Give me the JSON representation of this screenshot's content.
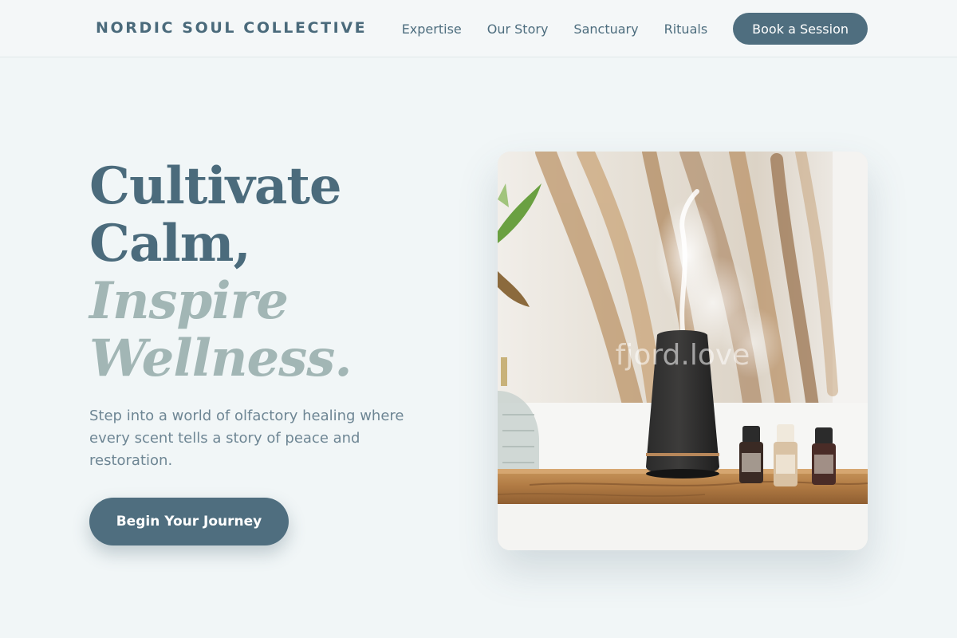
{
  "header": {
    "brand": "NORDIC SOUL COLLECTIVE",
    "nav": [
      {
        "label": "Expertise"
      },
      {
        "label": "Our Story"
      },
      {
        "label": "Sanctuary"
      },
      {
        "label": "Rituals"
      }
    ],
    "book_label": "Book a Session"
  },
  "hero": {
    "title_line1": "Cultivate",
    "title_line2": "Calm,",
    "title_line3": "Inspire",
    "title_line4": "Wellness.",
    "subtitle": "Step into a world of olfactory healing where every scent tells a story of peace and restoration.",
    "cta_label": "Begin Your Journey",
    "image_watermark": "fjord.love"
  },
  "colors": {
    "primary": "#4f6e7f",
    "accent": "#a2b6b5",
    "background": "#f1f6f7"
  }
}
